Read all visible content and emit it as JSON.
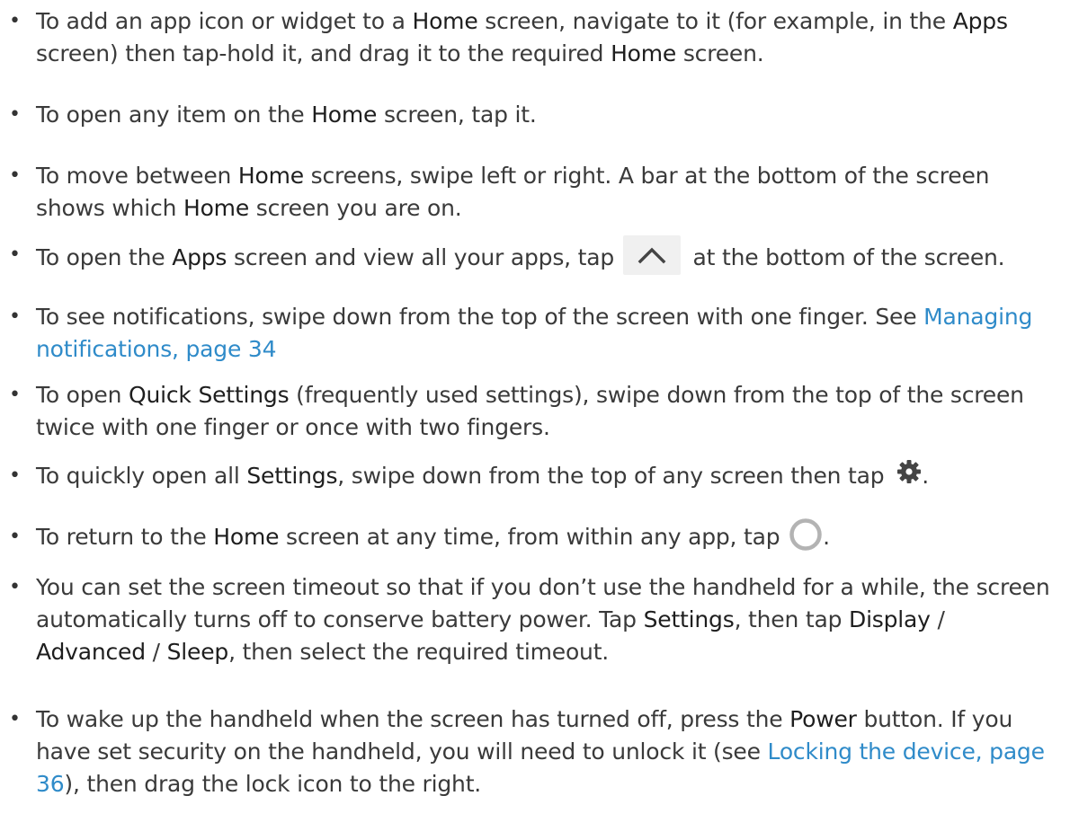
{
  "bullet_glyph": "•",
  "items": [
    {
      "parts": [
        {
          "t": "To add an app icon or widget to a "
        },
        {
          "t": "Home",
          "kw": true
        },
        {
          "t": " screen, navigate to it (for example, in the "
        },
        {
          "t": "Apps",
          "kw": true
        },
        {
          "t": " screen) then tap-hold it, and drag it to the required "
        },
        {
          "t": "Home",
          "kw": true
        },
        {
          "t": " screen."
        }
      ]
    },
    {
      "parts": [
        {
          "t": "To open any item on the "
        },
        {
          "t": "Home",
          "kw": true
        },
        {
          "t": " screen, tap it."
        }
      ]
    },
    {
      "parts": [
        {
          "t": "To move between "
        },
        {
          "t": "Home",
          "kw": true
        },
        {
          "t": " screens, swipe left or right. A bar at the bottom of the screen shows which "
        },
        {
          "t": "Home",
          "kw": true
        },
        {
          "t": " screen you are on."
        }
      ]
    },
    {
      "parts": [
        {
          "t": "To open the "
        },
        {
          "t": "Apps",
          "kw": true
        },
        {
          "t": " screen and view all your apps, tap "
        },
        {
          "icon": "chevron-up-icon"
        },
        {
          "t": " at the bottom of the screen."
        }
      ]
    },
    {
      "parts": [
        {
          "t": "To see notifications, swipe down from the top of the screen with one finger. See "
        },
        {
          "link": "Managing notifications, page 34"
        }
      ]
    },
    {
      "parts": [
        {
          "t": "To open "
        },
        {
          "t": "Quick Settings",
          "kw": true
        },
        {
          "t": " (frequently used settings), swipe down from the top of the screen twice with one finger or once with two fingers."
        }
      ]
    },
    {
      "parts": [
        {
          "t": "To quickly open all "
        },
        {
          "t": "Settings",
          "kw": true
        },
        {
          "t": ", swipe down from the top of any screen then tap "
        },
        {
          "icon": "gear-icon"
        },
        {
          "t": "."
        }
      ]
    },
    {
      "parts": [
        {
          "t": "To return to the "
        },
        {
          "t": "Home",
          "kw": true
        },
        {
          "t": " screen at any time, from within any app, tap "
        },
        {
          "icon": "home-circle-icon"
        },
        {
          "t": "."
        }
      ]
    },
    {
      "parts": [
        {
          "t": "You can set the screen timeout so that if you don’t use the handheld for a while, the screen automatically turns off to conserve battery power. Tap "
        },
        {
          "t": "Settings",
          "kw": true
        },
        {
          "t": ", then tap "
        },
        {
          "t": "Display",
          "kw": true
        },
        {
          "t": " / "
        },
        {
          "t": "Advanced",
          "kw": true
        },
        {
          "t": " / "
        },
        {
          "t": "Sleep",
          "kw": true
        },
        {
          "t": ", then select the required timeout."
        }
      ]
    },
    {
      "parts": [
        {
          "t": "To wake up the handheld when the screen has turned off, press the "
        },
        {
          "t": "Power",
          "kw": true
        },
        {
          "t": " button. If you have set security on the handheld, you will need to unlock it (see "
        },
        {
          "link": "Locking the device, page 36"
        },
        {
          "t": "), then drag the lock icon to the right."
        }
      ]
    }
  ],
  "colors": {
    "text": "#3a3a3a",
    "keyword": "#1e1e1e",
    "link": "#2f8bc9",
    "icon_gray": "#b3b3b3",
    "icon_dark": "#444444"
  }
}
